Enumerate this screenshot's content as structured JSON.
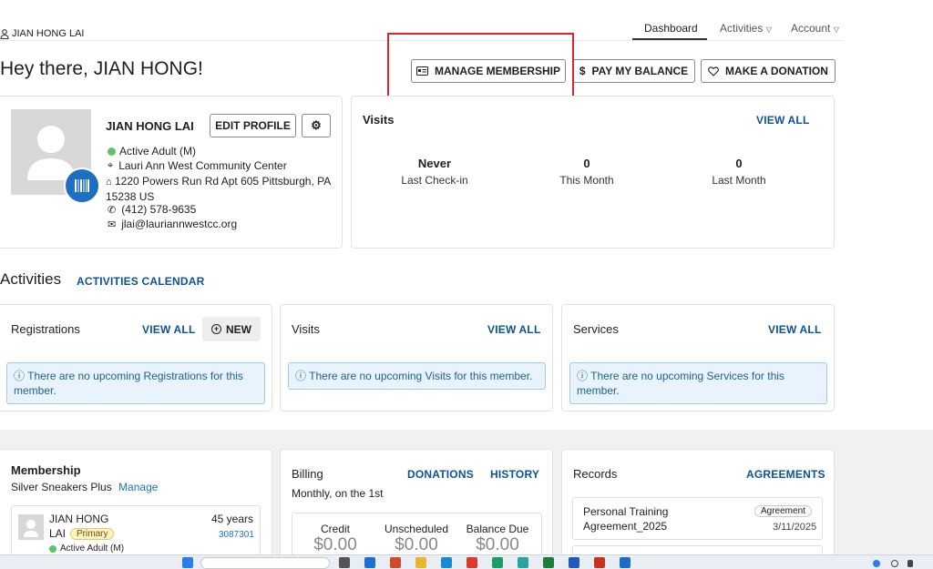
{
  "header": {
    "user_name": "JIAN HONG LAI",
    "nav": {
      "dashboard": "Dashboard",
      "activities": "Activities",
      "account": "Account"
    },
    "greeting": "Hey there, JIAN HONG!",
    "buttons": {
      "manage_membership": "MANAGE MEMBERSHIP",
      "pay_balance": "PAY MY BALANCE",
      "donation": "MAKE A DONATION"
    }
  },
  "profile": {
    "name": "JIAN HONG LAI",
    "edit_label": "EDIT PROFILE",
    "status": "Active Adult (M)",
    "location": "Lauri Ann West Community Center",
    "address": "1220 Powers Run Rd Apt 605 Pittsburgh, PA 15238 US",
    "phone": "(412) 578-9635",
    "email": "jlai@lauriannwestcc.org"
  },
  "visits_summary": {
    "title": "Visits",
    "view_all": "VIEW ALL",
    "stats": [
      {
        "value": "Never",
        "label": "Last Check-in"
      },
      {
        "value": "0",
        "label": "This Month"
      },
      {
        "value": "0",
        "label": "Last Month"
      }
    ]
  },
  "activities": {
    "heading": "Activities",
    "calendar_link": "ACTIVITIES CALENDAR",
    "registrations": {
      "title": "Registrations",
      "view_all": "VIEW ALL",
      "new": "NEW",
      "message": "There are no upcoming Registrations for this member."
    },
    "visits": {
      "title": "Visits",
      "view_all": "VIEW ALL",
      "message": "There are no upcoming Visits for this member."
    },
    "services": {
      "title": "Services",
      "view_all": "VIEW ALL",
      "message": "There are no upcoming Services for this member."
    }
  },
  "membership": {
    "title": "Membership",
    "plan": "Silver Sneakers Plus",
    "manage": "Manage",
    "member_first": "JIAN HONG",
    "member_last": "LAI",
    "badge": "Primary",
    "age": "45 years",
    "id": "3087301",
    "status": "Active Adult (M)"
  },
  "billing": {
    "title": "Billing",
    "donations": "DONATIONS",
    "history": "HISTORY",
    "schedule": "Monthly, on the 1st",
    "columns": [
      {
        "label": "Credit",
        "value": "$0.00"
      },
      {
        "label": "Unscheduled",
        "value": "$0.00"
      },
      {
        "label": "Balance Due",
        "value": "$0.00"
      }
    ]
  },
  "records": {
    "title": "Records",
    "agreements": "AGREEMENTS",
    "item_name": "Personal Training Agreement_2025",
    "item_badge": "Agreement",
    "item_date": "3/11/2025"
  },
  "colors": {
    "accent": "#0b5394",
    "highlight": "#d9272e",
    "status_green": "#5cc26b"
  }
}
